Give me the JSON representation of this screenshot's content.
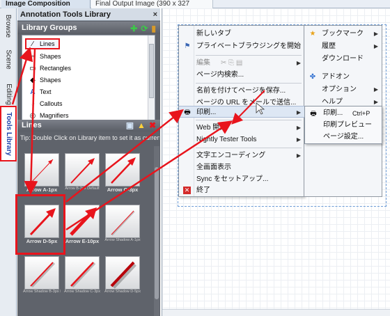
{
  "tabs": {
    "active": "Image Composition",
    "inactive": "Final Output Image (390 x 327 pixels)"
  },
  "vtabs": {
    "browse": "Browse",
    "scene": "Scene",
    "editing": "Editing",
    "tools": "Tools Library"
  },
  "panel": {
    "title": "Annotation Tools Library",
    "close": "×",
    "groups_header": "Library Groups",
    "groups": [
      {
        "label": "Lines",
        "icon": "line-icon"
      },
      {
        "label": "Shapes",
        "icon": "shapes-icon"
      },
      {
        "label": "Rectangles",
        "icon": "rectangle-icon"
      },
      {
        "label": "Shapes",
        "icon": "shapes-icon"
      },
      {
        "label": "Text",
        "icon": "text-icon"
      },
      {
        "label": "Callouts",
        "icon": "callout-icon"
      },
      {
        "label": "Magnifiers",
        "icon": "magnifier-icon"
      }
    ],
    "lines_header": "Lines",
    "tip": "Tip: Double Click on Library item to set it as current a...",
    "thumbnails": [
      "Arrow A-1px",
      "Arrow B-3px Default",
      "Arrow C-3px",
      "Arrow D-5px",
      "Arrow E-10px",
      "Arrow Shadow A-1px",
      "Arrow Shadow B-3px Default",
      "Arrow Shadow C-3px",
      "Arrow Shadow D-5px"
    ]
  },
  "context_menu": {
    "items": [
      {
        "label": "新しいタブ",
        "icon": "",
        "submenu": false,
        "disabled": false
      },
      {
        "label": "プライベートブラウジングを開始",
        "icon": "private-browsing-icon",
        "submenu": false,
        "disabled": false
      },
      {
        "label": "編集",
        "icon": "",
        "submenu": true,
        "disabled": true
      },
      {
        "label": "ページ内検索...",
        "icon": "",
        "submenu": false,
        "disabled": false
      },
      {
        "label": "名前を付けてページを保存...",
        "icon": "",
        "submenu": false,
        "disabled": false
      },
      {
        "label": "ページの URL をメールで送信...",
        "icon": "",
        "submenu": false,
        "disabled": false
      },
      {
        "label": "印刷...",
        "icon": "printer-icon",
        "submenu": true,
        "disabled": false
      },
      {
        "label": "Web 開発",
        "icon": "",
        "submenu": true,
        "disabled": false
      },
      {
        "label": "Nightly Tester Tools",
        "icon": "",
        "submenu": true,
        "disabled": false
      },
      {
        "label": "文字エンコーディング",
        "icon": "",
        "submenu": true,
        "disabled": false
      },
      {
        "label": "全画面表示",
        "icon": "",
        "submenu": false,
        "disabled": false
      },
      {
        "label": "Sync をセットアップ...",
        "icon": "",
        "submenu": false,
        "disabled": false
      },
      {
        "label": "終了",
        "icon": "exit-icon",
        "submenu": false,
        "disabled": false
      }
    ],
    "right_items": [
      {
        "label": "ブックマーク",
        "icon": "star-icon",
        "submenu": true
      },
      {
        "label": "履歴",
        "icon": "",
        "submenu": true
      },
      {
        "label": "ダウンロード",
        "icon": "",
        "submenu": false
      },
      {
        "label": "アドオン",
        "icon": "puzzle-icon",
        "submenu": false
      },
      {
        "label": "オプション",
        "icon": "",
        "submenu": true
      },
      {
        "label": "ヘルプ",
        "icon": "",
        "submenu": true
      }
    ]
  },
  "submenu": {
    "items": [
      {
        "label": "印刷...",
        "shortcut": "Ctrl+P",
        "icon": "printer-icon"
      },
      {
        "label": "印刷プレビュー",
        "shortcut": "",
        "icon": ""
      },
      {
        "label": "ページ設定...",
        "shortcut": "",
        "icon": ""
      }
    ]
  },
  "colors": {
    "annotation_red": "#e8141c",
    "panel_bg": "#5f636b",
    "canvas_guide": "#6b9bd6"
  }
}
